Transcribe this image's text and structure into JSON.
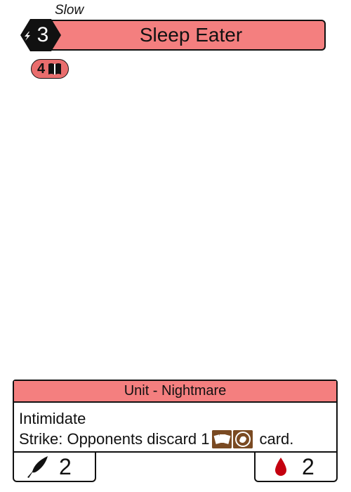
{
  "card": {
    "speed": "Slow",
    "cost": "3",
    "name": "Sleep Eater",
    "badge_value": "4",
    "type_line": "Unit - Nightmare",
    "rules": {
      "line1": "Intimidate",
      "line2_prefix": "Strike: Opponents discard 1",
      "line2_suffix": "card."
    },
    "power": "2",
    "health": "2"
  },
  "colors": {
    "header": "#f47f7f",
    "badge": "#e96d6d",
    "resource_icon": "#7a4a22",
    "blood": "#c4000f"
  },
  "icons": {
    "cost": "lightning-hex-icon",
    "badge": "book-icon",
    "resource_1": "cards-icon",
    "resource_2": "hand-icon",
    "power": "quill-icon",
    "health": "blood-drop-icon"
  }
}
